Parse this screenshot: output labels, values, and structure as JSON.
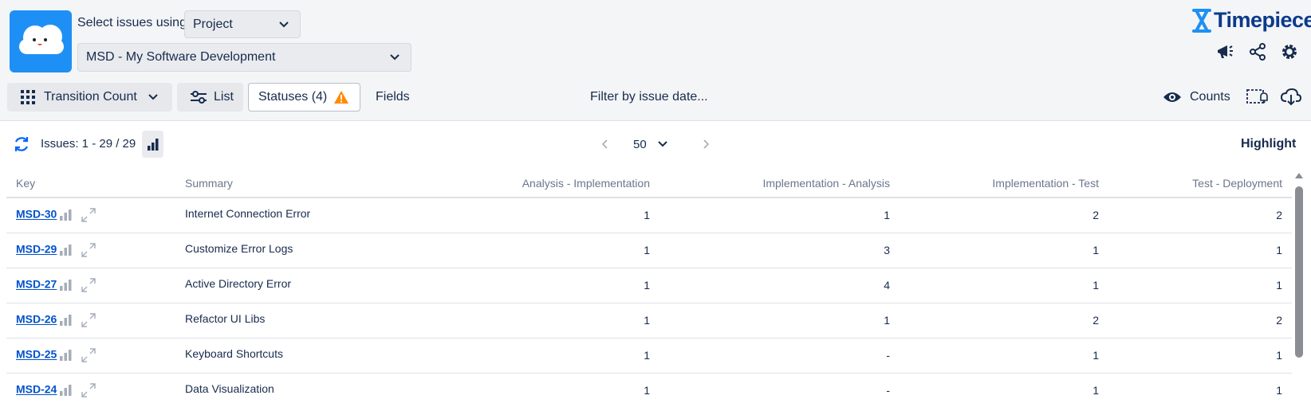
{
  "header": {
    "select_label": "Select issues using",
    "select_type": "Project",
    "project": "MSD - My Software Development",
    "brand": "Timepiece"
  },
  "toolbar": {
    "report_type": "Transition Count",
    "list_label": "List",
    "statuses_label": "Statuses (4)",
    "fields_label": "Fields",
    "filter_label": "Filter by issue date...",
    "counts_label": "Counts"
  },
  "subbar": {
    "issues_label": "Issues: 1 - 29 / 29",
    "page_size": "50",
    "highlight_label": "Highlight"
  },
  "table": {
    "columns": [
      "Key",
      "Summary",
      "Analysis - Implementation",
      "Implementation - Analysis",
      "Implementation - Test",
      "Test - Deployment"
    ],
    "rows": [
      {
        "key": "MSD-30",
        "summary": "Internet Connection Error",
        "c1": "1",
        "c2": "1",
        "c3": "2",
        "c4": "2"
      },
      {
        "key": "MSD-29",
        "summary": "Customize Error Logs",
        "c1": "1",
        "c2": "3",
        "c3": "1",
        "c4": "1"
      },
      {
        "key": "MSD-27",
        "summary": "Active Directory Error",
        "c1": "1",
        "c2": "4",
        "c3": "1",
        "c4": "1"
      },
      {
        "key": "MSD-26",
        "summary": "Refactor UI Libs",
        "c1": "1",
        "c2": "1",
        "c3": "2",
        "c4": "2"
      },
      {
        "key": "MSD-25",
        "summary": "Keyboard Shortcuts",
        "c1": "1",
        "c2": "-",
        "c3": "1",
        "c4": "1"
      },
      {
        "key": "MSD-24",
        "summary": "Data Visualization",
        "c1": "1",
        "c2": "-",
        "c3": "1",
        "c4": "1"
      }
    ]
  },
  "colors": {
    "logo_bg": "#1e90f5",
    "brand": "#0b3a8c",
    "warning": "#ff8b00",
    "link": "#0052cc"
  }
}
